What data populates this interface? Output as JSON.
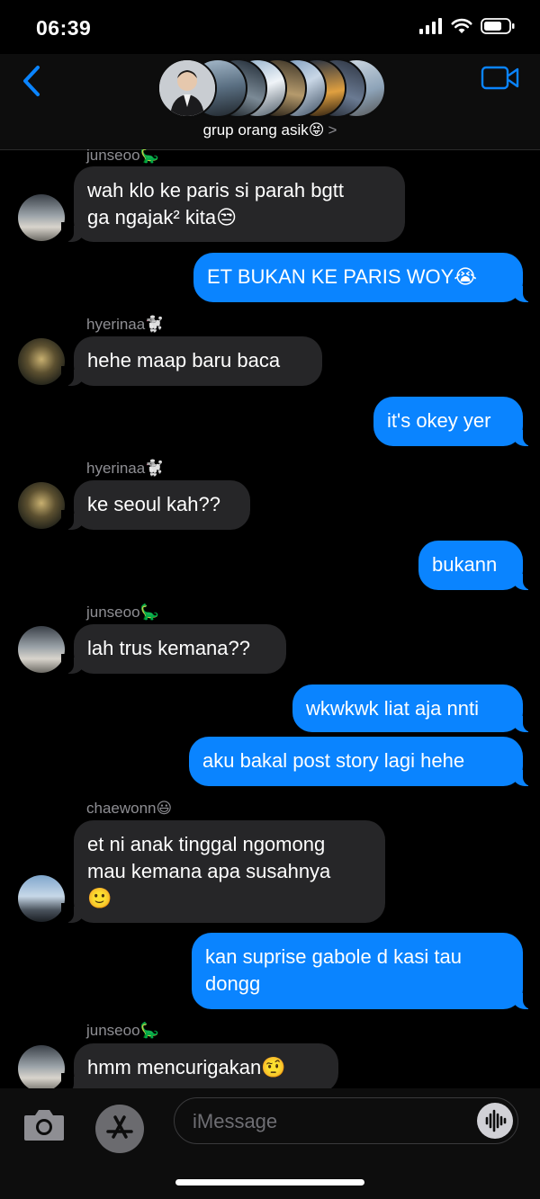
{
  "status_bar": {
    "time": "06:39"
  },
  "header": {
    "group_name": "grup orang asik😝",
    "chevron": ">"
  },
  "messages": [
    {
      "sender": "junseoo🦕"
    },
    {
      "text": "wah klo ke paris si parah bgtt\nga ngajak² kita😒"
    },
    {
      "text": "ET BUKAN KE PARIS WOY😭"
    },
    {
      "sender": "hyerinaa🐩"
    },
    {
      "text": "hehe maap baru baca"
    },
    {
      "text": "it's okey yer"
    },
    {
      "sender": "hyerinaa🐩"
    },
    {
      "text": "ke seoul kah??"
    },
    {
      "text": "bukann"
    },
    {
      "sender": "junseoo🦕"
    },
    {
      "text": "lah trus kemana??"
    },
    {
      "text": "wkwkwk liat aja nnti"
    },
    {
      "text": "aku bakal post story lagi hehe"
    },
    {
      "sender": "chaewonn😃"
    },
    {
      "text": "et ni anak tinggal ngomong\nmau kemana apa susahnya\n🙂"
    },
    {
      "text": "kan suprise gabole d kasi tau\ndongg"
    },
    {
      "sender": "junseoo🦕"
    },
    {
      "text": "hmm mencurigakan🤨"
    }
  ],
  "input": {
    "placeholder": "iMessage"
  },
  "colors": {
    "accent": "#0a84ff",
    "incoming": "#262628",
    "background": "#000000"
  }
}
